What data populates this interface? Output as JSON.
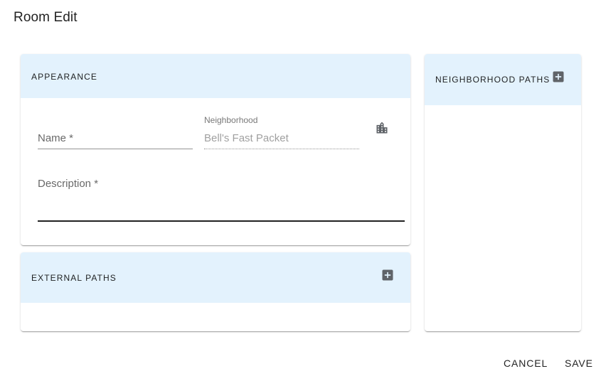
{
  "dialog": {
    "title": "Room Edit"
  },
  "appearance": {
    "header": "APPEARANCE",
    "name": {
      "label": "Name *",
      "value": ""
    },
    "neighborhood": {
      "label": "Neighborhood",
      "value": "Bell's Fast Packet",
      "icon": "city-icon"
    },
    "description": {
      "label": "Description *",
      "value": ""
    }
  },
  "external_paths": {
    "header": "EXTERNAL PATHS",
    "add_icon": "add-box-icon"
  },
  "neighborhood_paths": {
    "header": "NEIGHBORHOOD PATHS",
    "add_icon": "add-box-icon"
  },
  "actions": {
    "cancel": "CANCEL",
    "save": "SAVE"
  },
  "colors": {
    "header_bg": "#e3f2fd",
    "icon": "#5f6368"
  }
}
